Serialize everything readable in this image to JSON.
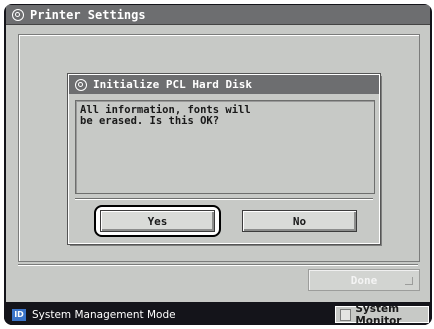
{
  "window": {
    "title": "Printer Settings",
    "icon": "gear-icon"
  },
  "dialog": {
    "title": "Initialize PCL Hard Disk",
    "message": "All information, fonts will\nbe erased. Is this OK?",
    "yes_label": "Yes",
    "no_label": "No"
  },
  "footer": {
    "done_label": "Done"
  },
  "status_bar": {
    "badge": "ID",
    "mode_text": "System Management Mode",
    "monitor_label": "System Monitor"
  },
  "colors": {
    "panel": "#c7c9c6",
    "title_bar": "#6d6e70",
    "screen_bezel": "#14141a",
    "id_badge": "#3a74c9"
  }
}
